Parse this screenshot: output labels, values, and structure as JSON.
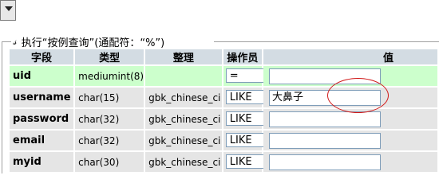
{
  "legend": {
    "text": "执行“按例查询”(通配符：“%”)",
    "icon": "query-icon"
  },
  "columns": [
    "字段",
    "类型",
    "整理",
    "操作员",
    "值"
  ],
  "rows": [
    {
      "field": "uid",
      "type": "mediumint(8)",
      "collation": "",
      "operator": "=",
      "value": ""
    },
    {
      "field": "username",
      "type": "char(15)",
      "collation": "gbk_chinese_ci",
      "operator": "LIKE",
      "value": "大鼻子"
    },
    {
      "field": "password",
      "type": "char(32)",
      "collation": "gbk_chinese_ci",
      "operator": "LIKE",
      "value": ""
    },
    {
      "field": "email",
      "type": "char(32)",
      "collation": "gbk_chinese_ci",
      "operator": "LIKE",
      "value": ""
    },
    {
      "field": "myid",
      "type": "char(30)",
      "collation": "gbk_chinese_ci",
      "operator": "LIKE",
      "value": ""
    }
  ],
  "colors": {
    "header_bg": "#d3dce3",
    "row_highlight": "#ccffcc",
    "row_normal": "#e5e5e5",
    "annotation": "#d11a1a"
  }
}
